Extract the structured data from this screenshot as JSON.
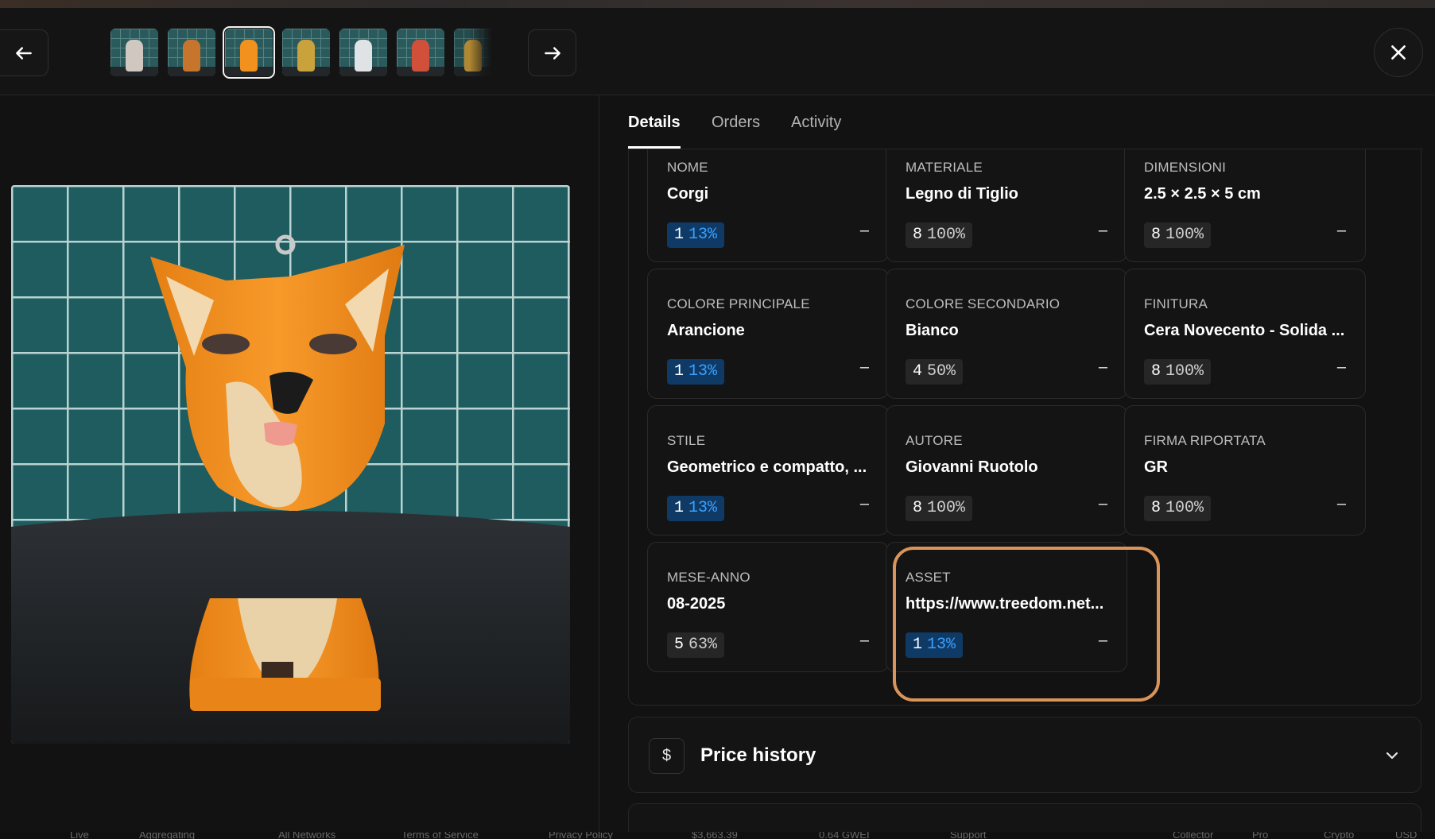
{
  "thumbnails": [
    {
      "name": "thumb-1",
      "color": "#cfc7c0"
    },
    {
      "name": "thumb-2",
      "color": "#c7742c"
    },
    {
      "name": "thumb-3",
      "color": "#f2911e"
    },
    {
      "name": "thumb-4",
      "color": "#c9a23b"
    },
    {
      "name": "thumb-5",
      "color": "#dfe3e6"
    },
    {
      "name": "thumb-6",
      "color": "#d0503a"
    },
    {
      "name": "thumb-7",
      "color": "#d9a63a"
    }
  ],
  "tabs": [
    "Details",
    "Orders",
    "Activity"
  ],
  "traits": [
    {
      "label": "NOME",
      "value": "Corgi",
      "count": "1",
      "pct": "13%",
      "highlight": true
    },
    {
      "label": "MATERIALE",
      "value": "Legno di Tiglio",
      "count": "8",
      "pct": "100%",
      "highlight": false
    },
    {
      "label": "DIMENSIONI",
      "value": "2.5 × 2.5 × 5 cm",
      "count": "8",
      "pct": "100%",
      "highlight": false
    },
    {
      "label": "COLORE PRINCIPALE",
      "value": "Arancione",
      "count": "1",
      "pct": "13%",
      "highlight": true
    },
    {
      "label": "COLORE SECONDARIO",
      "value": "Bianco",
      "count": "4",
      "pct": "50%",
      "highlight": false
    },
    {
      "label": "FINITURA",
      "value": "Cera Novecento - Solida ...",
      "count": "8",
      "pct": "100%",
      "highlight": false
    },
    {
      "label": "STILE",
      "value": "Geometrico e compatto, ...",
      "count": "1",
      "pct": "13%",
      "highlight": true
    },
    {
      "label": "AUTORE",
      "value": "Giovanni Ruotolo",
      "count": "8",
      "pct": "100%",
      "highlight": false
    },
    {
      "label": "FIRMA RIPORTATA",
      "value": "GR",
      "count": "8",
      "pct": "100%",
      "highlight": false
    },
    {
      "label": "MESE-ANNO",
      "value": "08-2025",
      "count": "5",
      "pct": "63%",
      "highlight": false
    },
    {
      "label": "ASSET",
      "value": "https://www.treedom.net...",
      "count": "1",
      "pct": "13%",
      "highlight": true
    }
  ],
  "trait_dash": "–",
  "price_history": {
    "icon": "$",
    "title": "Price history"
  },
  "statusbar": [
    "Live",
    "Aggregating",
    "All Networks",
    "Terms of Service",
    "Privacy Policy",
    "$3,663.39",
    "0.64 GWEI",
    "Support",
    "Collector",
    "Pro",
    "Crypto",
    "USD"
  ],
  "colors": {
    "accent_highlight": "#d9945a",
    "rarity_blue": "#3aa0ff",
    "rarity_bg": "#0f3a66"
  }
}
